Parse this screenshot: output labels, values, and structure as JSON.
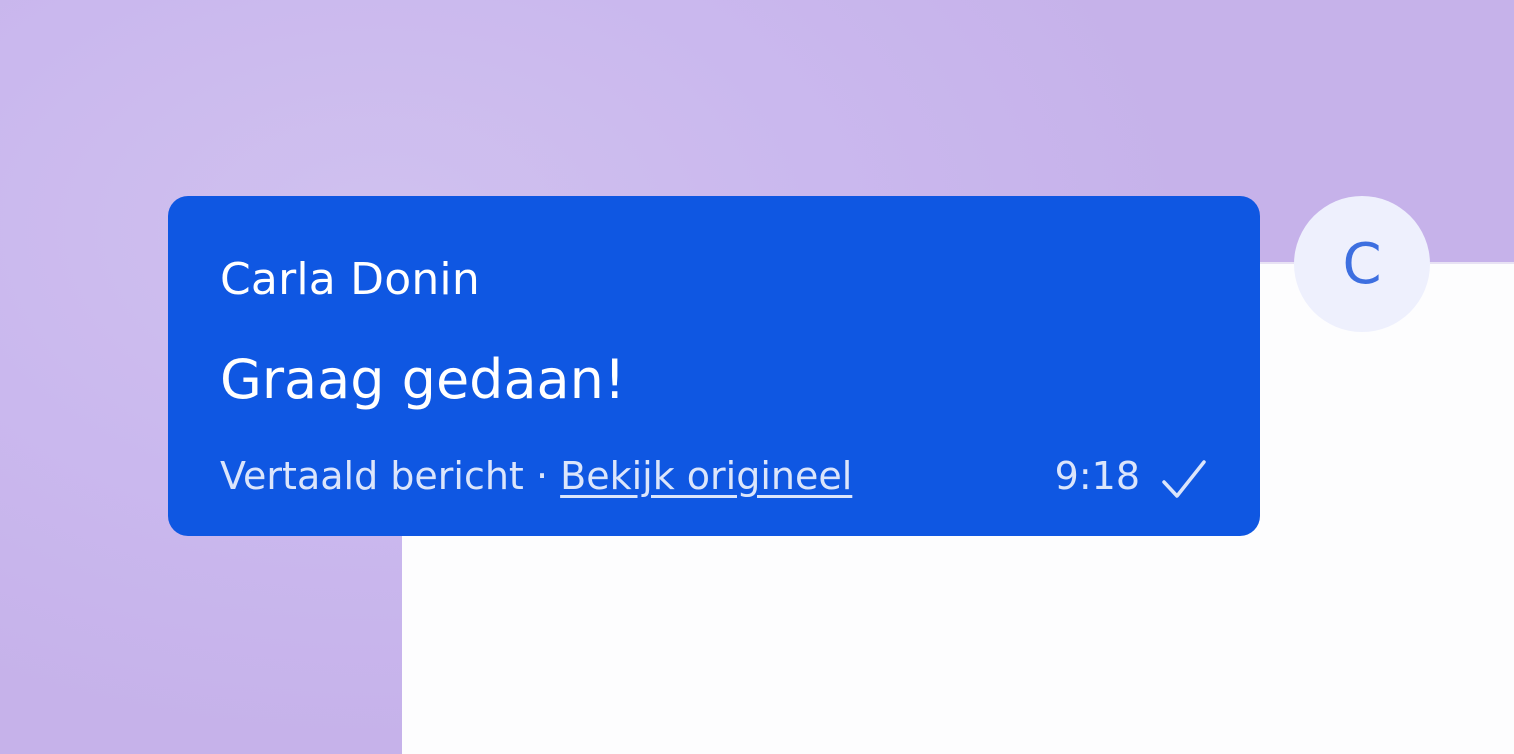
{
  "message": {
    "sender": "Carla Donin",
    "text": "Graag gedaan!",
    "translated_label": "Vertaald bericht",
    "separator": "·",
    "view_original_link": "Bekijk origineel",
    "time": "9:18",
    "status_icon": "check-icon"
  },
  "avatar": {
    "initial": "C"
  },
  "colors": {
    "bubble": "#0f57e2",
    "background": "#c6b2ea",
    "panel": "#fdfdfe",
    "avatar_bg": "#eef0fd",
    "avatar_text": "#3d6fe0"
  }
}
